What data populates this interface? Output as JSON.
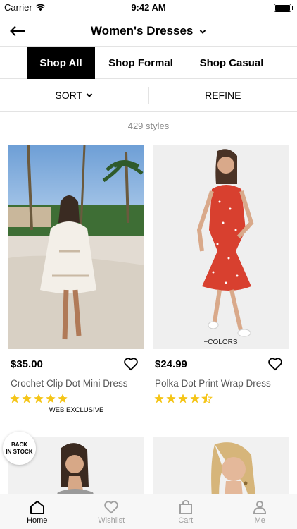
{
  "status": {
    "carrier": "Carrier",
    "time": "9:42 AM"
  },
  "header": {
    "title": "Women's Dresses"
  },
  "tabs": [
    {
      "label": "Shop All",
      "active": true
    },
    {
      "label": "Shop Formal",
      "active": false
    },
    {
      "label": "Shop Casual",
      "active": false
    }
  ],
  "controls": {
    "sort_label": "SORT",
    "refine_label": "REFINE"
  },
  "results": {
    "count_text": "429 styles"
  },
  "products": [
    {
      "price": "$35.00",
      "name": "Crochet Clip Dot Mini Dress",
      "rating": 5,
      "badge_below": "WEB EXCLUSIVE",
      "image_caption": ""
    },
    {
      "price": "$24.99",
      "name": "Polka Dot Print Wrap Dress",
      "rating": 4.5,
      "badge_below": "",
      "image_caption": "+COLORS"
    },
    {
      "price": "",
      "name": "",
      "rating": 0,
      "badge_below": "",
      "image_caption": ""
    },
    {
      "price": "",
      "name": "",
      "rating": 0,
      "badge_below": "",
      "image_caption": ""
    }
  ],
  "badge": {
    "line1": "BACK",
    "line2": "IN STOCK"
  },
  "tabbar": [
    {
      "label": "Home",
      "icon": "home-icon",
      "active": true
    },
    {
      "label": "Wishlist",
      "icon": "heart-icon",
      "active": false
    },
    {
      "label": "Cart",
      "icon": "bag-icon",
      "active": false
    },
    {
      "label": "Me",
      "icon": "person-icon",
      "active": false
    }
  ],
  "colors": {
    "star": "#f5c518",
    "dress_red": "#d8402f",
    "active_tab_bg": "#000000"
  }
}
